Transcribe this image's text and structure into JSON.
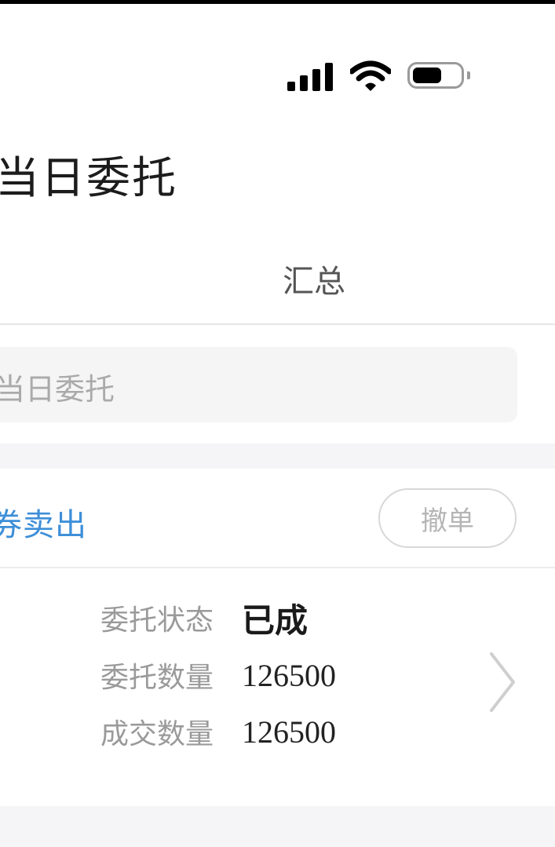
{
  "status_bar": {
    "signal_icon": "signal-bars-icon",
    "wifi_icon": "wifi-icon",
    "battery_icon": "battery-icon"
  },
  "header": {
    "title": "当日委托"
  },
  "tabs": {
    "summary_label": "汇总"
  },
  "search": {
    "placeholder": "当日委托"
  },
  "order": {
    "type_label": "券卖出",
    "cancel_label": "撤单",
    "fields": [
      {
        "label": "委托状态",
        "value": "已成"
      },
      {
        "label": "委托数量",
        "value": "126500"
      },
      {
        "label": "成交数量",
        "value": "126500"
      }
    ],
    "chevron_icon": "chevron-right-icon"
  },
  "colors": {
    "accent": "#3e8fd8",
    "background": "#f5f5f7"
  }
}
